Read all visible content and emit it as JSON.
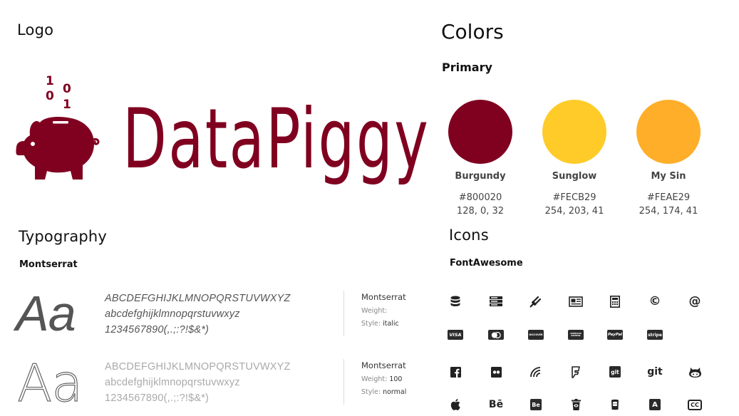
{
  "logo": {
    "heading": "Logo",
    "wordmark": "DataPiggy",
    "binary_digits": [
      "1",
      "0",
      "0",
      "1"
    ],
    "brand_color": "#800020"
  },
  "colors": {
    "heading": "Colors",
    "subheading": "Primary",
    "swatches": [
      {
        "name": "Burgundy",
        "hex": "#800020",
        "rgb": "128, 0, 32"
      },
      {
        "name": "Sunglow",
        "hex": "#FECB29",
        "rgb": "254, 203, 41"
      },
      {
        "name": "My Sin",
        "hex": "#FEAE29",
        "rgb": "254, 174, 41"
      }
    ]
  },
  "typography": {
    "heading": "Typography",
    "subheading": "Montserrat",
    "samples": [
      {
        "glyph": "Aa",
        "uppercase": "ABCDEFGHIJKLMNOPQRSTUVWXYZ",
        "lowercase": "abcdefghijklmnopqrstuvwxyz",
        "numerals": "1234567890(,.;:?!$&*)",
        "font_name": "Montserrat",
        "weight_label": "Weight:",
        "weight_value": "",
        "style_label": "Style:",
        "style_value": "italic"
      },
      {
        "glyph": "Aa",
        "uppercase": "ABCDEFGHIJKLMNOPQRSTUVWXYZ",
        "lowercase": "abcdefghijklmnopqrstuvwxyz",
        "numerals": "1234567890(,.;:?!$&*)",
        "font_name": "Montserrat",
        "weight_label": "Weight:",
        "weight_value": "100",
        "style_label": "Style:",
        "style_value": "normal"
      }
    ]
  },
  "icons": {
    "heading": "Icons",
    "subheading": "FontAwesome",
    "card_labels": {
      "visa": "VISA",
      "discover": "DISCOVER",
      "amex": "AMERICAN EXPRESS",
      "paypal": "PayPal",
      "stripe": "stripe"
    },
    "glyph_labels": {
      "copyright": "©",
      "at": "@",
      "git_square": "git",
      "git": "git",
      "behance": "Bē",
      "behance_square": "Be",
      "font": "A",
      "cc": "CC"
    },
    "rows": [
      [
        "database-icon",
        "server-icon",
        "plug-icon",
        "newspaper-icon",
        "calculator-icon",
        "copyright-icon",
        "at-icon"
      ],
      [
        "cc-visa-icon",
        "cc-mastercard-icon",
        "cc-discover-icon",
        "cc-amex-icon",
        "cc-paypal-icon",
        "cc-stripe-icon"
      ],
      [
        "facebook-square-icon",
        "flickr-icon",
        "wifi-icon",
        "foursquare-icon",
        "git-square-icon",
        "git-icon",
        "github-alt-icon"
      ],
      [
        "apple-icon",
        "behance-icon",
        "behance-square-icon",
        "trash-icon",
        "beer-icon",
        "font-icon",
        "closed-captioning-icon"
      ]
    ]
  }
}
